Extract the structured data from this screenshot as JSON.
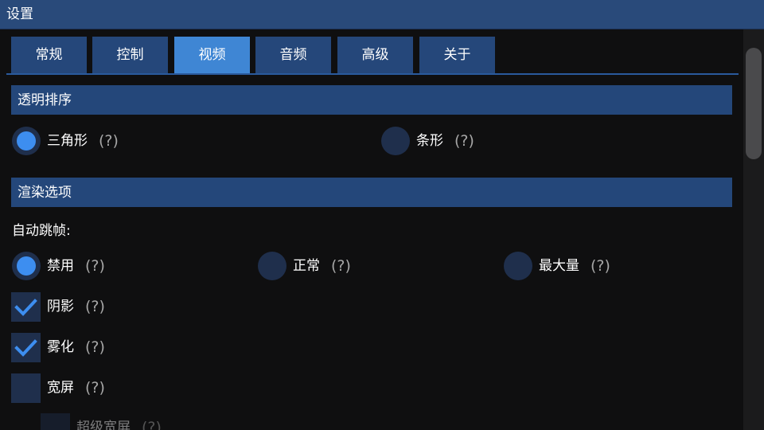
{
  "window": {
    "title": "设置"
  },
  "tabs": [
    {
      "label": "常规",
      "active": false
    },
    {
      "label": "控制",
      "active": false
    },
    {
      "label": "视频",
      "active": true
    },
    {
      "label": "音频",
      "active": false
    },
    {
      "label": "高级",
      "active": false
    },
    {
      "label": "关于",
      "active": false
    }
  ],
  "transparency_section": {
    "title": "透明排序",
    "options": [
      {
        "label": "三角形",
        "help": "(?)",
        "selected": true
      },
      {
        "label": "条形",
        "help": "(?)",
        "selected": false
      }
    ]
  },
  "render_section": {
    "title": "渲染选项",
    "auto_frameskip_label": "自动跳帧:",
    "frameskip_options": [
      {
        "label": "禁用",
        "help": "(?)",
        "selected": true
      },
      {
        "label": "正常",
        "help": "(?)",
        "selected": false
      },
      {
        "label": "最大量",
        "help": "(?)",
        "selected": false
      }
    ],
    "checkboxes": [
      {
        "label": "阴影",
        "help": "(?)",
        "checked": true
      },
      {
        "label": "雾化",
        "help": "(?)",
        "checked": true
      },
      {
        "label": "宽屏",
        "help": "(?)",
        "checked": false
      },
      {
        "label": "超级宽屏",
        "help": "(?)",
        "checked": false
      }
    ]
  },
  "colors": {
    "titlebar": "#294a7a",
    "tab": "#25477a",
    "tab_active": "#3f86d4",
    "section_header": "#24477a",
    "radio_off": "#1f2f4c",
    "radio_on": "#3d8ef0",
    "check_mark": "#3d8ef0"
  }
}
